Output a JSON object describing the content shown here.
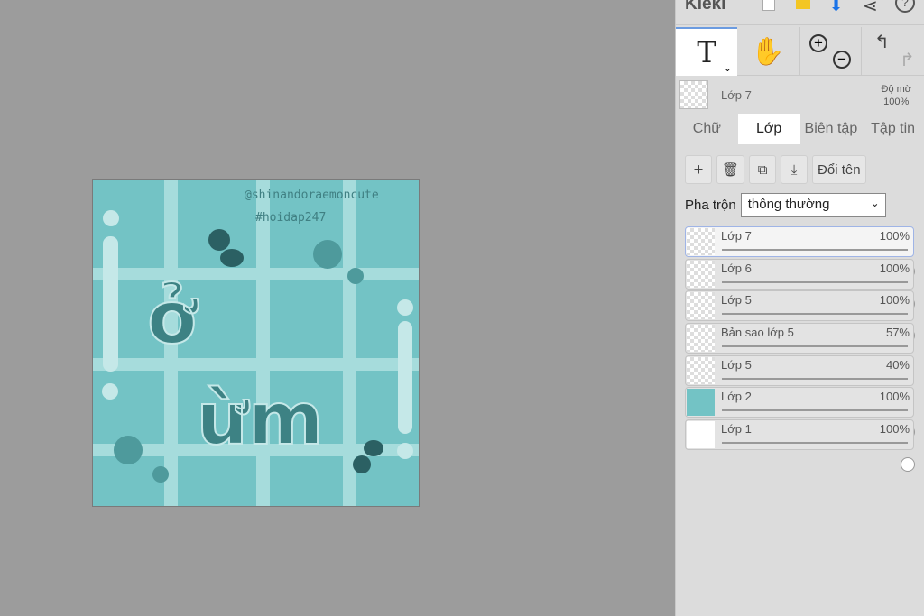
{
  "app": {
    "logo": "Kleki"
  },
  "toolbar": {
    "tools": [
      "text-tool",
      "hand-tool",
      "zoom-in",
      "zoom-out",
      "undo",
      "redo"
    ],
    "text_tool_glyph": "T"
  },
  "current_layer": {
    "name": "Lớp 7",
    "opacity_label": "Độ mờ",
    "opacity": "100%"
  },
  "tabs": [
    {
      "label": "Chữ"
    },
    {
      "label": "Lớp",
      "active": true
    },
    {
      "label": "Biên tập"
    },
    {
      "label": "Tập tin"
    }
  ],
  "layer_actions": {
    "rename": "Đổi tên"
  },
  "blend": {
    "label": "Pha trộn",
    "value": "thông thường"
  },
  "layers": [
    {
      "name": "Lớp 7",
      "opacity": "100%",
      "value": 100,
      "selected": true
    },
    {
      "name": "Lớp 6",
      "opacity": "100%",
      "value": 100
    },
    {
      "name": "Lớp 5",
      "opacity": "100%",
      "value": 100
    },
    {
      "name": "Bản sao lớp 5",
      "opacity": "57%",
      "value": 57
    },
    {
      "name": "Lớp 5",
      "opacity": "40%",
      "value": 40
    },
    {
      "name": "Lớp 2",
      "opacity": "100%",
      "value": 100,
      "color": "#73c3c5"
    },
    {
      "name": "Lớp 1",
      "opacity": "100%",
      "value": 100,
      "color": "#ffffff"
    }
  ],
  "artwork": {
    "handle": "@shinandoraemoncute",
    "hashtag": "#hoidap247",
    "lettering": "ở ừm",
    "bg": "#73c3c5",
    "grid": "#a6dcdc",
    "dark": "#2b6063",
    "mid": "#4e9a9c"
  }
}
